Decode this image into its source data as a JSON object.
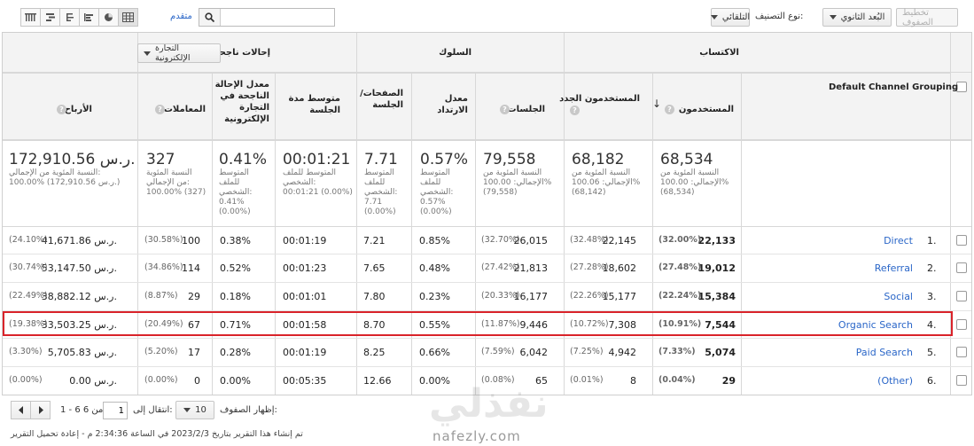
{
  "toolbar": {
    "plot_rows_label": "تخطيط الصفوف",
    "secondary_dim_label": "البُعد الثانوي",
    "sort_type_label": "نوع التصنيف:",
    "sort_type_value": "التلقائي",
    "advanced_link": "متقدم",
    "search_placeholder": ""
  },
  "groups": {
    "acquisition": "الاكتساب",
    "behavior": "السلوك",
    "conversions": "إحالات ناجحة",
    "conversion_select": "التجارة الإلكترونية"
  },
  "columns": {
    "channel": "Default Channel Grouping",
    "users": "المستخدمون",
    "new_users": "المستخدمون الجدد",
    "sessions": "الجلسات",
    "bounce_rate": "معدل الارتداد",
    "pages_session": "الصفحات/ الجلسة",
    "avg_duration": "متوسط مدة الجلسة",
    "conv_rate": "معدل الإحالة الناجحة في التجارة الإلكترونية",
    "transactions": "المعاملات",
    "revenue": "الأرباح"
  },
  "totals": {
    "users": {
      "big": "68,534",
      "small": "النسبة المئوية من\nالإجمالي: 100.00%\n(68,534)"
    },
    "new_users": {
      "big": "68,182",
      "small": "النسبة المئوية من\nالإجمالي: 100.06%\n(68,142)"
    },
    "sessions": {
      "big": "79,558",
      "small": "النسبة المئوية من\nالإجمالي: 100.00%\n(79,558)"
    },
    "bounce_rate": {
      "big": "0.57%",
      "small": "المتوسط\nللملف\nالشخصي:\n0.57%\n(0.00%)"
    },
    "pages_session": {
      "big": "7.71",
      "small": "المتوسط\nللملف\nالشخصي:\n7.71\n(0.00%)"
    },
    "avg_duration": {
      "big": "00:01:21",
      "small": "المتوسط للملف\nالشخصي:\n00:01:21 (0.00%)"
    },
    "conv_rate": {
      "big": "0.41%",
      "small": "المتوسط\nللملف\nالشخصي:\n0.41%\n(0.00%)"
    },
    "transactions": {
      "big": "327",
      "small": "النسبة المئوية\nمن الإجمالي:\n100.00% (327)"
    },
    "revenue": {
      "big": "172,910.56 ر.س.",
      "small": "النسبة المئوية من الإجمالي:\n100.00% (172,910.56 ر.س.)"
    }
  },
  "rows": [
    {
      "idx": "1.",
      "channel": "Direct",
      "users": "22,133",
      "users_pct": "(32.00%)",
      "new_users": "22,145",
      "new_users_pct": "(32.48%)",
      "sessions": "26,015",
      "sessions_pct": "(32.70%)",
      "bounce": "0.85%",
      "pages": "7.21",
      "duration": "00:01:19",
      "conv": "0.38%",
      "trans": "100",
      "trans_pct": "(30.58%)",
      "revenue": "41,671.86 ر.س.",
      "revenue_pct": "(24.10%)"
    },
    {
      "idx": "2.",
      "channel": "Referral",
      "users": "19,012",
      "users_pct": "(27.48%)",
      "new_users": "18,602",
      "new_users_pct": "(27.28%)",
      "sessions": "21,813",
      "sessions_pct": "(27.42%)",
      "bounce": "0.48%",
      "pages": "7.65",
      "duration": "00:01:23",
      "conv": "0.52%",
      "trans": "114",
      "trans_pct": "(34.86%)",
      "revenue": "53,147.50 ر.س.",
      "revenue_pct": "(30.74%)"
    },
    {
      "idx": "3.",
      "channel": "Social",
      "users": "15,384",
      "users_pct": "(22.24%)",
      "new_users": "15,177",
      "new_users_pct": "(22.26%)",
      "sessions": "16,177",
      "sessions_pct": "(20.33%)",
      "bounce": "0.23%",
      "pages": "7.80",
      "duration": "00:01:01",
      "conv": "0.18%",
      "trans": "29",
      "trans_pct": "(8.87%)",
      "revenue": "38,882.12 ر.س.",
      "revenue_pct": "(22.49%)"
    },
    {
      "idx": "4.",
      "channel": "Organic Search",
      "users": "7,544",
      "users_pct": "(10.91%)",
      "new_users": "7,308",
      "new_users_pct": "(10.72%)",
      "sessions": "9,446",
      "sessions_pct": "(11.87%)",
      "bounce": "0.55%",
      "pages": "8.70",
      "duration": "00:01:58",
      "conv": "0.71%",
      "trans": "67",
      "trans_pct": "(20.49%)",
      "revenue": "33,503.25 ر.س.",
      "revenue_pct": "(19.38%)"
    },
    {
      "idx": "5.",
      "channel": "Paid Search",
      "users": "5,074",
      "users_pct": "(7.33%)",
      "new_users": "4,942",
      "new_users_pct": "(7.25%)",
      "sessions": "6,042",
      "sessions_pct": "(7.59%)",
      "bounce": "0.66%",
      "pages": "8.25",
      "duration": "00:01:19",
      "conv": "0.28%",
      "trans": "17",
      "trans_pct": "(5.20%)",
      "revenue": "5,705.83 ر.س.",
      "revenue_pct": "(3.30%)"
    },
    {
      "idx": "6.",
      "channel": "(Other)",
      "users": "29",
      "users_pct": "(0.04%)",
      "new_users": "8",
      "new_users_pct": "(0.01%)",
      "sessions": "65",
      "sessions_pct": "(0.08%)",
      "bounce": "0.00%",
      "pages": "12.66",
      "duration": "00:05:35",
      "conv": "0.00%",
      "trans": "0",
      "trans_pct": "(0.00%)",
      "revenue": "0.00 ر.س.",
      "revenue_pct": "(0.00%)"
    }
  ],
  "footer": {
    "show_rows_label": "إظهار الصفوف:",
    "show_rows_value": "10",
    "goto_label": "انتقال إلى:",
    "goto_value": "1",
    "range": "1 - 6 من 6",
    "report_note": "تم إنشاء هذا التقرير بتاريخ 2023/2/3 في الساعة 2:34:36 م - إعادة تحميل التقرير"
  },
  "watermark": {
    "arabic": "نفذلي",
    "latin": "nafezly.com"
  },
  "colors": {
    "link": "#2a66c8",
    "highlight": "#d9232a",
    "header_bg": "#f3f3f3"
  }
}
